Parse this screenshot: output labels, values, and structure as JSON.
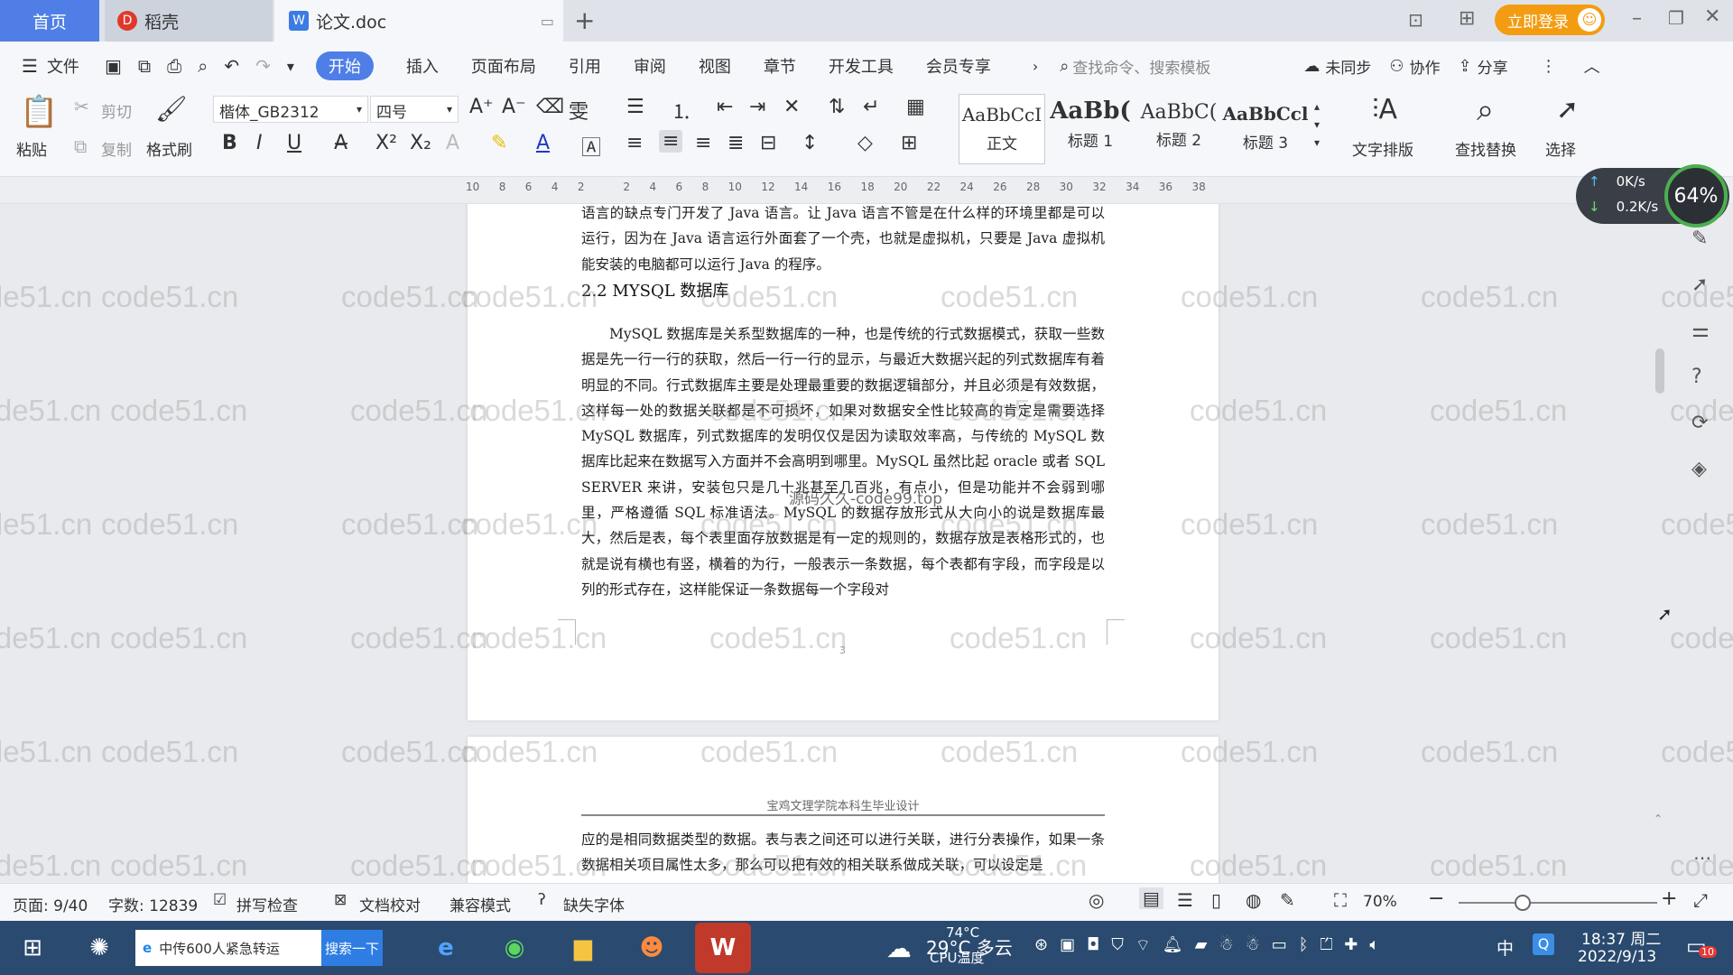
{
  "tabs": {
    "home": "首页",
    "daoke": "稻壳",
    "doc": "论文.doc",
    "login": "立即登录"
  },
  "menu": {
    "file": "文件",
    "start": "开始",
    "insert": "插入",
    "layout": "页面布局",
    "ref": "引用",
    "review": "审阅",
    "view": "视图",
    "chapter": "章节",
    "devtools": "开发工具",
    "member": "会员专享",
    "search_cmd": "查找命令、搜索模板",
    "unsync": "未同步",
    "collab": "协作",
    "share": "分享"
  },
  "ribbon": {
    "paste": "粘贴",
    "cut": "剪切",
    "copy": "复制",
    "format_painter": "格式刷",
    "font_name": "楷体_GB2312",
    "font_size": "四号",
    "styles": [
      {
        "sample": "AaBbCcI",
        "name": "正文"
      },
      {
        "sample": "AaBb(",
        "name": "标题 1"
      },
      {
        "sample": "AaBbC(",
        "name": "标题 2"
      },
      {
        "sample": "AaBbCcl",
        "name": "标题 3"
      }
    ],
    "text_layout": "文字排版",
    "find_replace": "查找替换",
    "select": "选择"
  },
  "ruler_ticks": [
    "10",
    "8",
    "6",
    "4",
    "2",
    "",
    "2",
    "4",
    "6",
    "8",
    "10",
    "12",
    "14",
    "16",
    "18",
    "20",
    "22",
    "24",
    "26",
    "28",
    "30",
    "32",
    "34",
    "36",
    "38"
  ],
  "net": {
    "up": "0K/s",
    "down": "0.2K/s",
    "cpu": "64%"
  },
  "document": {
    "para1": "语言的缺点专门开发了 Java 语言。让 Java 语言不管是在什么样的环境里都是可以运行，因为在 Java 语言运行外面套了一个壳，也就是虚拟机，只要是 Java 虚拟机能安装的电脑都可以运行 Java 的程序。",
    "heading": "2.2 MYSQL 数据库",
    "para2": "MySQL 数据库是关系型数据库的一种，也是传统的行式数据模式，获取一些数据是先一行一行的获取，然后一行一行的显示，与最近大数据兴起的列式数据库有着明显的不同。行式数据库主要是处理最重要的数据逻辑部分，并且必须是有效数据，这样每一处的数据关联都是不可损坏，如果对数据安全性比较高的肯定是需要选择 MySQL 数据库，列式数据库的发明仅仅是因为读取效率高，与传统的 MySQL 数据库比起来在数据写入方面并不会高明到哪里。MySQL 虽然比起 oracle 或者 SQL SERVER 来讲，安装包只是几十兆甚至几百兆，有点小，但是功能并不会弱到哪里，严格遵循 SQL 标准语法。MySQL 的数据存放形式从大向小的说是数据库最大，然后是表，每个表里面存放数据是有一定的规则的，数据存放是表格形式的，也就是说有横也有竖，横着的为行，一般表示一条数据，每个表都有字段，而字段是以列的形式存在，这样能保证一条数据每一个字段对",
    "overlay": "源码久久-code99.top",
    "page_num": "3",
    "page2_header": "宝鸡文理学院本科生毕业设计",
    "para3": "应的是相同数据类型的数据。表与表之间还可以进行关联，进行分表操作，如果一条数据相关项目属性太多，那么可以把有效的相关联系做成关联，可以设定是"
  },
  "watermark": "code51.cn",
  "status": {
    "page": "页面: 9/40",
    "words": "字数: 12839",
    "spell": "拼写检查",
    "proof": "文档校对",
    "compat": "兼容模式",
    "missing_font": "缺失字体",
    "zoom": "70%"
  },
  "taskbar": {
    "news": "中传600人紧急转运",
    "search_btn": "搜索一下",
    "weather_temp": "29°C 多云",
    "cpu_temp": "74°C",
    "cpu_label": "CPU温度",
    "ime": "中",
    "time": "18:37 周二",
    "date": "2022/9/13",
    "notif": "10"
  }
}
